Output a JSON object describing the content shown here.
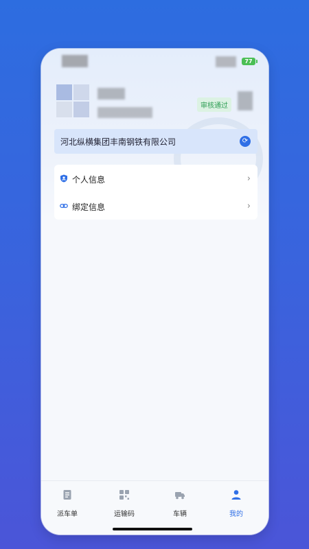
{
  "status": {
    "battery": "77",
    "wifi_icon": "wifi-icon"
  },
  "profile": {
    "badge": "审核通过"
  },
  "company": {
    "name": "河北纵横集团丰南钢铁有限公司"
  },
  "menu": [
    {
      "label": "个人信息",
      "icon": "shield-user-icon"
    },
    {
      "label": "绑定信息",
      "icon": "link-icon"
    }
  ],
  "tabbar": {
    "items": [
      {
        "label": "派车单",
        "icon": "document-icon"
      },
      {
        "label": "运输码",
        "icon": "qr-code-icon"
      },
      {
        "label": "车辆",
        "icon": "truck-icon"
      },
      {
        "label": "我的",
        "icon": "user-icon"
      }
    ],
    "active_index": 3,
    "accent": "#2f6fe6"
  }
}
